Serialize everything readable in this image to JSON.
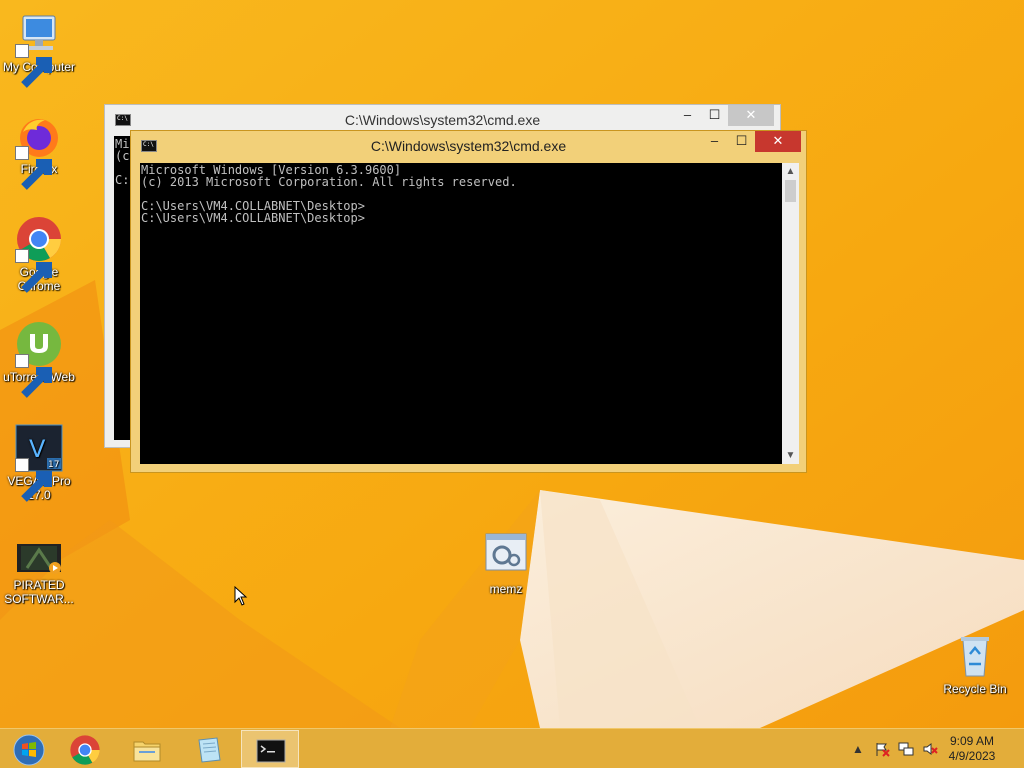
{
  "desktop": {
    "icons": [
      {
        "label": "My Computer",
        "icon": "computer-icon"
      },
      {
        "label": "Firefox",
        "icon": "firefox-icon"
      },
      {
        "label": "Google Chrome",
        "icon": "chrome-icon"
      },
      {
        "label": "uTorrent Web",
        "icon": "utorrent-icon"
      },
      {
        "label": "VEGAS Pro 17.0",
        "icon": "vegas-icon",
        "badge": "17",
        "letter": "V"
      },
      {
        "label": "PIRATED SOFTWAR...",
        "icon": "video-file-icon"
      },
      {
        "label": "memz",
        "icon": "memz-exe-icon"
      },
      {
        "label": "Recycle Bin",
        "icon": "recycle-bin-icon"
      }
    ]
  },
  "windows": {
    "back": {
      "title": "C:\\Windows\\system32\\cmd.exe",
      "console_lines": [
        "Mi",
        "(c",
        "",
        "C:"
      ]
    },
    "front": {
      "title": "C:\\Windows\\system32\\cmd.exe",
      "console_lines": [
        "Microsoft Windows [Version 6.3.9600]",
        "(c) 2013 Microsoft Corporation. All rights reserved.",
        "",
        "C:\\Users\\VM4.COLLABNET\\Desktop>",
        "C:\\Users\\VM4.COLLABNET\\Desktop>"
      ]
    },
    "controls": {
      "minimize": "–",
      "maximize": "☐",
      "close": "✕"
    }
  },
  "taskbar": {
    "pinned": [
      "start-button",
      "chrome",
      "file-explorer",
      "notepad",
      "cmd"
    ],
    "active": "cmd",
    "clock_time": "9:09 AM",
    "clock_date": "4/9/2023",
    "tray": [
      "show-hidden-icons",
      "action-center-flag",
      "network",
      "volume-muted"
    ]
  },
  "colors": {
    "wallpaper": "#f6a816",
    "taskbar": "#e3ad3a",
    "active_window_frame": "#f2d079",
    "close_button": "#c7372e"
  }
}
